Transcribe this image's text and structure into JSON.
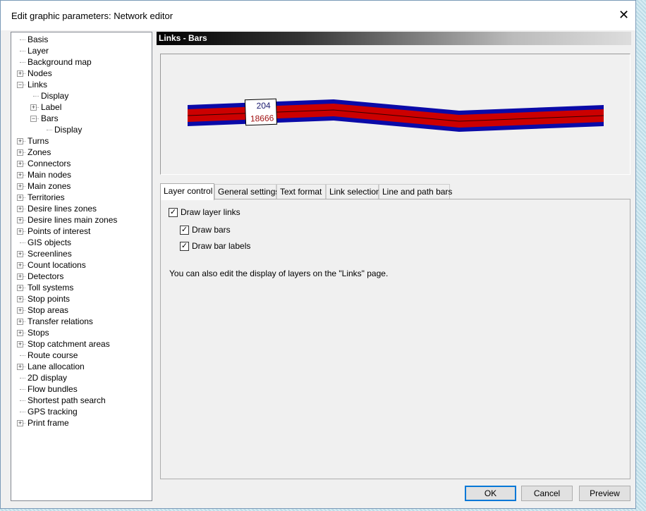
{
  "window": {
    "title": "Edit graphic parameters: Network editor",
    "close": "✕"
  },
  "tree": [
    {
      "label": "Basis",
      "level": 0,
      "exp": ""
    },
    {
      "label": "Layer",
      "level": 0,
      "exp": ""
    },
    {
      "label": "Background map",
      "level": 0,
      "exp": ""
    },
    {
      "label": "Nodes",
      "level": 0,
      "exp": "+"
    },
    {
      "label": "Links",
      "level": 0,
      "exp": "-"
    },
    {
      "label": "Display",
      "level": 1,
      "exp": ""
    },
    {
      "label": "Label",
      "level": 1,
      "exp": "+"
    },
    {
      "label": "Bars",
      "level": 1,
      "exp": "-"
    },
    {
      "label": "Display",
      "level": 2,
      "exp": ""
    },
    {
      "label": "Turns",
      "level": 0,
      "exp": "+"
    },
    {
      "label": "Zones",
      "level": 0,
      "exp": "+"
    },
    {
      "label": "Connectors",
      "level": 0,
      "exp": "+"
    },
    {
      "label": "Main nodes",
      "level": 0,
      "exp": "+"
    },
    {
      "label": "Main zones",
      "level": 0,
      "exp": "+"
    },
    {
      "label": "Territories",
      "level": 0,
      "exp": "+"
    },
    {
      "label": "Desire lines zones",
      "level": 0,
      "exp": "+"
    },
    {
      "label": "Desire lines main zones",
      "level": 0,
      "exp": "+"
    },
    {
      "label": "Points of interest",
      "level": 0,
      "exp": "+"
    },
    {
      "label": "GIS objects",
      "level": 0,
      "exp": ""
    },
    {
      "label": "Screenlines",
      "level": 0,
      "exp": "+"
    },
    {
      "label": "Count locations",
      "level": 0,
      "exp": "+"
    },
    {
      "label": "Detectors",
      "level": 0,
      "exp": "+"
    },
    {
      "label": "Toll systems",
      "level": 0,
      "exp": "+"
    },
    {
      "label": "Stop points",
      "level": 0,
      "exp": "+"
    },
    {
      "label": "Stop areas",
      "level": 0,
      "exp": "+"
    },
    {
      "label": "Transfer relations",
      "level": 0,
      "exp": "+"
    },
    {
      "label": "Stops",
      "level": 0,
      "exp": "+"
    },
    {
      "label": "Stop catchment areas",
      "level": 0,
      "exp": "+"
    },
    {
      "label": "Route course",
      "level": 0,
      "exp": ""
    },
    {
      "label": "Lane allocation",
      "level": 0,
      "exp": "+"
    },
    {
      "label": "2D display",
      "level": 0,
      "exp": ""
    },
    {
      "label": "Flow bundles",
      "level": 0,
      "exp": ""
    },
    {
      "label": "Shortest path search",
      "level": 0,
      "exp": ""
    },
    {
      "label": "GPS tracking",
      "level": 0,
      "exp": ""
    },
    {
      "label": "Print frame",
      "level": 0,
      "exp": "+"
    }
  ],
  "section_title": "Links - Bars",
  "preview": {
    "bar_label_top": "204",
    "bar_label_bottom": "18666",
    "colors": {
      "outer": "#0a0aa8",
      "inner": "#cc0000"
    }
  },
  "tabs": [
    {
      "label": "Layer control",
      "active": true
    },
    {
      "label": "General settings"
    },
    {
      "label": "Text format"
    },
    {
      "label": "Link selection"
    },
    {
      "label": "Line and path bars"
    }
  ],
  "layer_control": {
    "draw_layer_links": {
      "label": "Draw layer links",
      "checked": true
    },
    "draw_bars": {
      "label": "Draw bars",
      "checked": true
    },
    "draw_bar_labels": {
      "label": "Draw bar labels",
      "checked": true
    },
    "note": "You can also edit the display of layers on the \"Links\" page."
  },
  "buttons": {
    "ok": "OK",
    "cancel": "Cancel",
    "preview": "Preview"
  }
}
